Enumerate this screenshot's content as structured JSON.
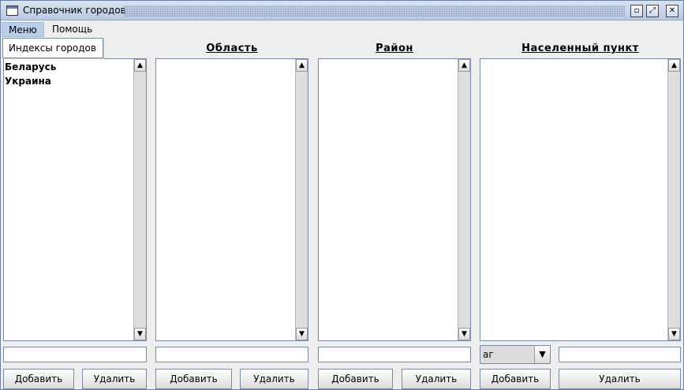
{
  "window": {
    "title": "Справочник городов"
  },
  "menubar": {
    "items": [
      {
        "label": "Меню"
      },
      {
        "label": "Помощь"
      }
    ],
    "dropdown_item": "Индексы городов"
  },
  "columns": [
    {
      "header": "",
      "items": [
        "Беларусь",
        "Украина"
      ],
      "add_label": "Добавить",
      "delete_label": "Удалить"
    },
    {
      "header": "Область",
      "items": [],
      "add_label": "Добавить",
      "delete_label": "Удалить"
    },
    {
      "header": "Район",
      "items": [],
      "add_label": "Добавить",
      "delete_label": "Удалить"
    },
    {
      "header": "Населенный пункт",
      "items": [],
      "add_label": "Добавить",
      "delete_label": "Удалить"
    }
  ],
  "locality_filter": {
    "selected": "аг"
  }
}
